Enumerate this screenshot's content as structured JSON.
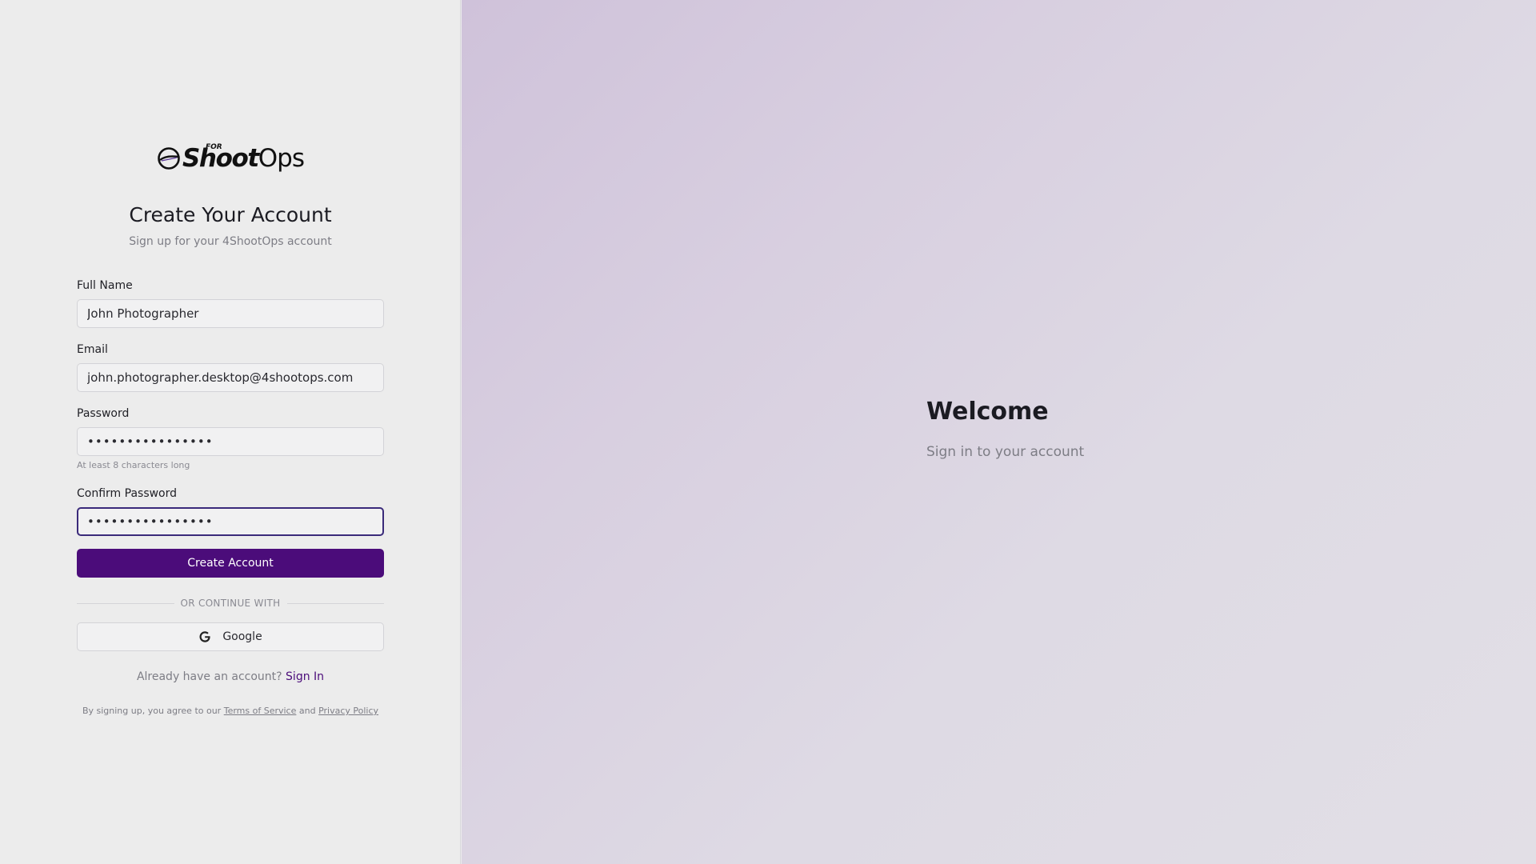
{
  "brand": {
    "logo_main": "Shoot",
    "logo_ops": "Ops",
    "logo_for": "FOR",
    "accent_color": "#4b0c7a"
  },
  "form": {
    "title": "Create Your Account",
    "subtitle": "Sign up for your 4ShootOps account",
    "full_name": {
      "label": "Full Name",
      "value": "John Photographer"
    },
    "email": {
      "label": "Email",
      "value": "john.photographer.desktop@4shootops.com"
    },
    "password": {
      "label": "Password",
      "value": "••••••••••••••••",
      "hint": "At least 8 characters long"
    },
    "confirm_password": {
      "label": "Confirm Password",
      "value": "••••••••••••••••"
    },
    "submit_label": "Create Account",
    "divider_text": "OR CONTINUE WITH",
    "google_label": "Google",
    "google_icon": "google-g-icon",
    "signin_prompt": "Already have an account?",
    "signin_link": "Sign In",
    "legal_prefix": "By signing up, you agree to our",
    "terms_link": "Terms of Service",
    "legal_and": "and",
    "privacy_link": "Privacy Policy"
  },
  "hero": {
    "title": "Welcome",
    "subtitle": "Sign in to your account"
  }
}
